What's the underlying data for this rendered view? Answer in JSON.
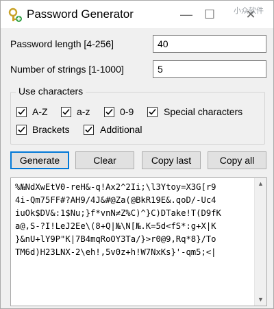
{
  "window": {
    "title": "Password Generator",
    "watermark": "小众软件",
    "controls": {
      "minimize": "—",
      "maximize": "☐",
      "close": "✕"
    }
  },
  "fields": {
    "length_label": "Password length [4-256]",
    "length_value": "40",
    "strings_label": "Number of strings [1-1000]",
    "strings_value": "5"
  },
  "use_characters": {
    "title": "Use characters",
    "options": [
      {
        "label": "A-Z",
        "checked": true
      },
      {
        "label": "a-z",
        "checked": true
      },
      {
        "label": "0-9",
        "checked": true
      },
      {
        "label": "Special characters",
        "checked": true
      },
      {
        "label": "Brackets",
        "checked": true
      },
      {
        "label": "Additional",
        "checked": true
      }
    ]
  },
  "buttons": {
    "generate": "Generate",
    "clear": "Clear",
    "copy_last": "Copy last",
    "copy_all": "Copy all"
  },
  "output": {
    "text": "%№NdXwEtV0-reH&-q!Ax2^2Ii;\\l3Ytoy=X3G[r9\n4i-Qm75FF#?AH9/4J&#@Za(@BkR19E&.qoD/-Uc4\niuOk$DV&:1$Nu;}f*vnN≠Z%C)^}C)DTake!T(D9fK\na@,S-?I!LeJ2Ee\\(8+Q|№\\N[№.K=5d<fS*:g+X|K\n}&nU+lY9P\"K|7B4mqRoOY3Ta/}>r0@9,Rq*8}/To\nTM6d)H23LNX-2\\eh!,5v0z+h!W7NxKs}'-qm5;<|"
  }
}
